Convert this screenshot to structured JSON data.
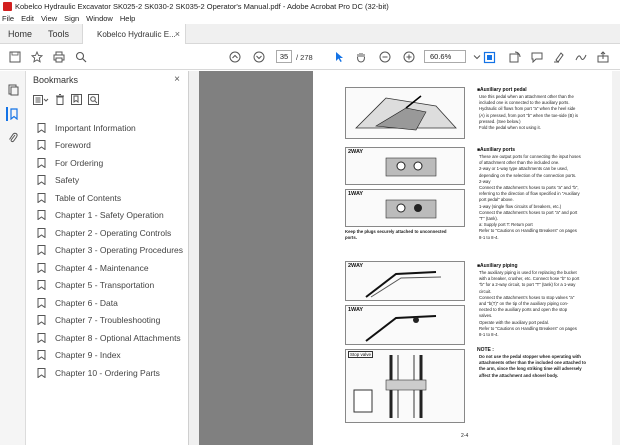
{
  "window": {
    "title": "Kobelco Hydraulic Excavator SK025-2 SK030-2 SK035-2 Operator's Manual.pdf - Adobe Acrobat Pro DC (32-bit)"
  },
  "menu": [
    "File",
    "Edit",
    "View",
    "Sign",
    "Window",
    "Help"
  ],
  "tabs": {
    "home": "Home",
    "tools": "Tools",
    "document": "Kobelco Hydraulic E...",
    "close": "×"
  },
  "toolbar": {
    "page_current": "35",
    "page_total": "/ 278",
    "zoom": "60.6%"
  },
  "bookmarks": {
    "header": "Bookmarks",
    "close": "×",
    "items": [
      "Important Information",
      "Foreword",
      "For Ordering",
      "Safety",
      "Table of Contents",
      "Chapter 1 - Safety Operation",
      "Chapter 2 - Operating Controls",
      "Chapter 3 - Operating Procedures",
      "Chapter 4 - Maintenance",
      "Chapter 5 - Transportation",
      "Chapter 6 - Data",
      "Chapter 7 - Troubleshooting",
      "Chapter 8 - Optional Attachments",
      "Chapter 9 - Index",
      "Chapter 10 - Ordering Parts"
    ]
  },
  "page": {
    "s1_title": "■Auxiliary port pedal",
    "s1_text": "Use this pedal when an attachment other than the\nincluded one is connected to the auxiliary ports.\nHydraulic oil flows from port \"a\" when the heel side\n(A) is pressed, from port \"b\" when the toe-side (B) is\npressed. (See below.)\nFold the pedal when not using it.",
    "s2_title": "■Auxiliary ports",
    "s2_text": "These are output ports for connecting the input hoses\nof attachment other than the included one.\n2-way or 1-way type attachments can be used,\ndepending on the selection of the connection ports.\n2-way\nConnect the attachment's hoses to ports \"a\" and \"b\",\nreferring to the direction of flow specified in \"Auxiliary\nport pedal\" above.\n1-way (single flow circuits of breakers, etc.)\nConnect the attachment's hoses to port \"a\" and port\n\"T\" (tank).\na: Supply port      T: Return port\nRefer to \"Cautions on Handling Breakers\" on pages\n8-1 to 8-4.",
    "s3_title": "■Auxiliary piping",
    "s3_text": "The auxiliary piping is used for replacing the bucket\nwith a breaker, crusher, etc. Connect hose \"b\" to port\n\"b\" for a 2-way circuit, to port \"T\" (tank) for a 1-way\ncircuit.\nConnect the attachment's hoses to stop valves \"a\"\nand \"b(T)\" on the tip of the auxiliary piping con-\nnected to the auxiliary ports and open the stop\nvalves.\nOperate with the auxiliary port pedal.\nRefer to \"Cautions on Handling Breakers\" on pages\n8-1 to 8-4.",
    "note_title": "NOTE :",
    "note_text": "Do not use the pedal stopper when operating with\nattachments other than the included one attached to\nthe arm, since the long striking time will adversely\naffect the attachment and shovel body.",
    "plug_note": "Keep the plugs securely attached to unconnected\nports.",
    "fig_2way": "2WAY",
    "fig_1way": "1WAY",
    "fig_2way_b": "2WAY",
    "fig_1way_b": "1WAY",
    "fig_stop_valve": "Stop valve",
    "page_number": "2-4"
  },
  "colors": {
    "accent": "#1473e6",
    "acrobat_red": "#d21f1f",
    "viewer_bg": "#808080"
  }
}
